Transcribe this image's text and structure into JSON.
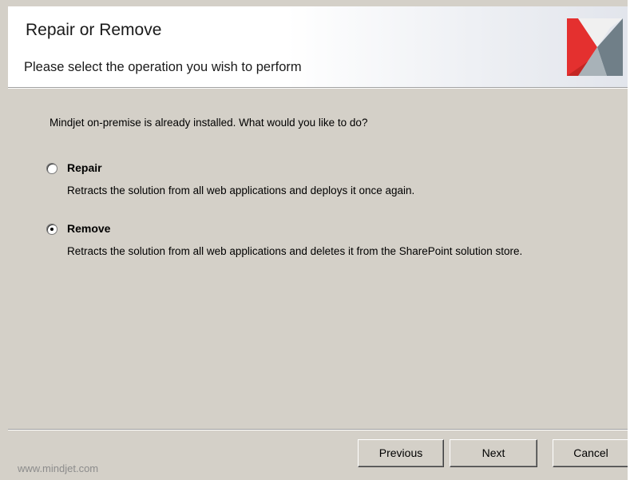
{
  "header": {
    "title": "Repair or Remove",
    "subtitle": "Please select the operation you wish to perform",
    "logo_icon": "mindjet-logo"
  },
  "main": {
    "intro": "Mindjet on-premise is already installed. What would you like to do?",
    "options": [
      {
        "label": "Repair",
        "description": "Retracts the solution from all web applications and deploys it once again.",
        "selected": false
      },
      {
        "label": "Remove",
        "description": "Retracts the solution from all web applications and deletes it from the SharePoint solution store.",
        "selected": true
      }
    ]
  },
  "footer": {
    "brand": "www.mindjet.com",
    "previous_label": "Previous",
    "next_label": "Next",
    "cancel_label": "Cancel"
  },
  "colors": {
    "dialog_background": "#d4d0c8",
    "logo_red": "#e4302f",
    "logo_gray": "#6e7f88",
    "brand_text": "#8c8c8c"
  }
}
